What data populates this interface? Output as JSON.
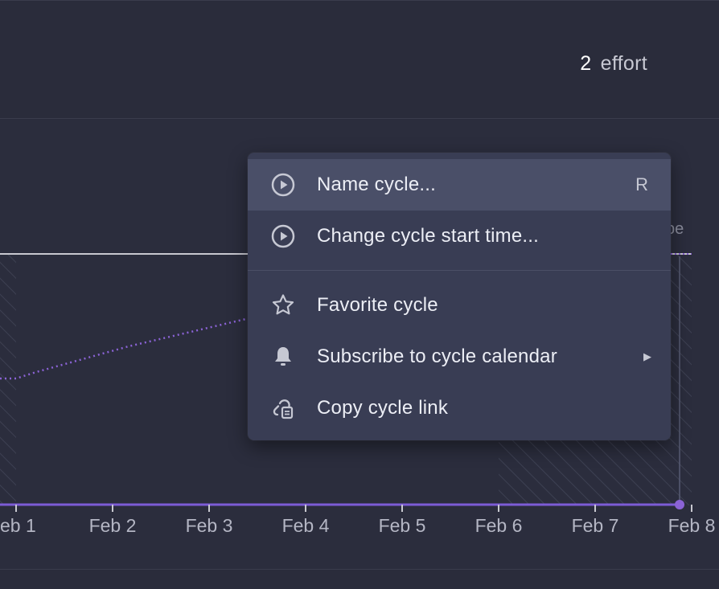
{
  "header": {
    "effort_count": "2",
    "effort_label": "effort"
  },
  "chart_data": {
    "type": "line",
    "x_tick_labels": [
      "eb 1",
      "Feb 2",
      "Feb 3",
      "Feb 4",
      "Feb 5",
      "Feb 6",
      "Feb 7",
      "Feb 8"
    ],
    "legend_partial_text": "pe",
    "series": [
      {
        "name": "",
        "style": "solid",
        "color": "#c8c8d0",
        "note": "scope"
      },
      {
        "name": "",
        "style": "dotted",
        "color": "#8b63d6"
      },
      {
        "name": "",
        "style": "solid",
        "color": "#7c5cd6"
      }
    ]
  },
  "context_menu": {
    "items": [
      {
        "label": "Name cycle...",
        "shortcut": "R",
        "icon": "play-circle-icon"
      },
      {
        "label": "Change cycle start time...",
        "icon": "play-circle-icon"
      },
      {
        "label": "Favorite cycle",
        "icon": "star-icon"
      },
      {
        "label": "Subscribe to cycle calendar",
        "icon": "bell-icon",
        "submenu_caret": "▶"
      },
      {
        "label": "Copy cycle link",
        "icon": "link-icon"
      }
    ]
  },
  "colors": {
    "background": "#292b3b",
    "menu_bg": "#393d54",
    "menu_hover": "#4a4f68",
    "accent_purple": "#7c5cd6"
  }
}
